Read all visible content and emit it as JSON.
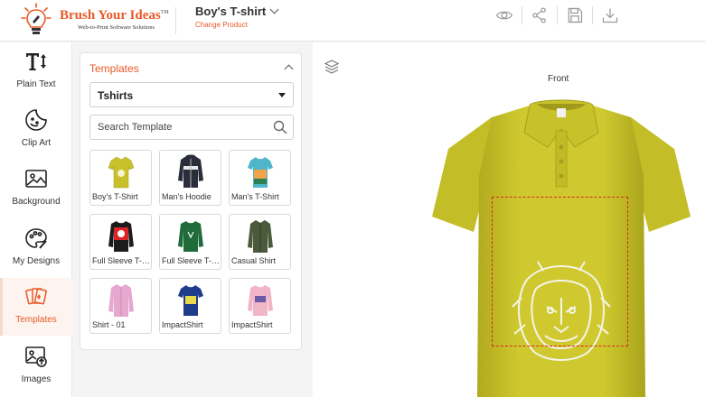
{
  "brand": {
    "name": "Brush Your Ideas",
    "trademark": "TM",
    "tagline": "Web-to-Print Software Solutions",
    "accent_color": "#e85a27"
  },
  "product": {
    "name": "Boy's T-shirt",
    "change_label": "Change Product"
  },
  "header_actions": [
    {
      "icon": "eye-icon"
    },
    {
      "icon": "share-icon"
    },
    {
      "icon": "save-icon"
    },
    {
      "icon": "download-icon"
    }
  ],
  "sidebar": {
    "items": [
      {
        "label": "Plain Text",
        "icon": "text-icon",
        "active": false
      },
      {
        "label": "Clip Art",
        "icon": "clipart-icon",
        "active": false
      },
      {
        "label": "Background",
        "icon": "image-icon",
        "active": false
      },
      {
        "label": "My Designs",
        "icon": "palette-icon",
        "active": false
      },
      {
        "label": "Templates",
        "icon": "templates-icon",
        "active": true
      },
      {
        "label": "Images",
        "icon": "upload-image-icon",
        "active": false
      }
    ]
  },
  "templates_panel": {
    "title": "Templates",
    "category_selected": "Tshirts",
    "search_placeholder": "Search Template",
    "templates": [
      {
        "name": "Boy's T-Shirt",
        "color": "#c9c12a"
      },
      {
        "name": "Man's Hoodie",
        "color": "#2a2d3a"
      },
      {
        "name": "Man's T-Shirt",
        "color": "#4fb6c9"
      },
      {
        "name": "Full Sleeve T-Shirt",
        "color": "#d9242a"
      },
      {
        "name": "Full Sleeve T-Shirt",
        "color": "#1f6b3a"
      },
      {
        "name": "Casual Shirt",
        "color": "#4a5a3a"
      },
      {
        "name": "Shirt - 01",
        "color": "#e6a8cf"
      },
      {
        "name": "ImpactShirt",
        "color": "#1f3b8c"
      },
      {
        "name": "ImpactShirt",
        "color": "#f1b5c8"
      }
    ]
  },
  "canvas": {
    "view": "Front",
    "shirt_color": "#c7c22e",
    "print_area_color": "#d6281e"
  }
}
